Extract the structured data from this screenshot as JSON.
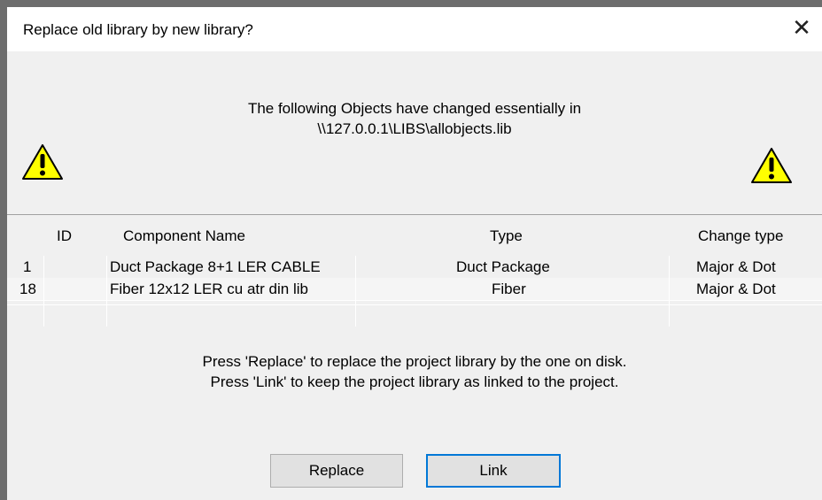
{
  "window": {
    "title": "Replace old library by new library?",
    "close_glyph": "✕"
  },
  "message": {
    "line1": "The following Objects have changed essentially in",
    "line2": "\\\\127.0.0.1\\LIBS\\allobjects.lib"
  },
  "icons": {
    "left": "warning-icon",
    "right": "warning-icon",
    "warning_fill": "#ffff00"
  },
  "table": {
    "headers": {
      "id": "ID",
      "name": "Component Name",
      "type": "Type",
      "change": "Change type"
    },
    "rows": [
      {
        "id": "1",
        "name": "Duct Package 8+1 LER CABLE",
        "type": "Duct Package",
        "change": "Major & Dot"
      },
      {
        "id": "18",
        "name": "Fiber 12x12 LER cu atr din lib",
        "type": "Fiber",
        "change": "Major & Dot"
      }
    ]
  },
  "instructions": {
    "line1": "Press 'Replace' to replace the project library by the one on disk.",
    "line2": "Press 'Link' to keep the project library as linked to the project."
  },
  "buttons": {
    "replace": "Replace",
    "link": "Link"
  },
  "colors": {
    "focus_border": "#0078d7"
  }
}
